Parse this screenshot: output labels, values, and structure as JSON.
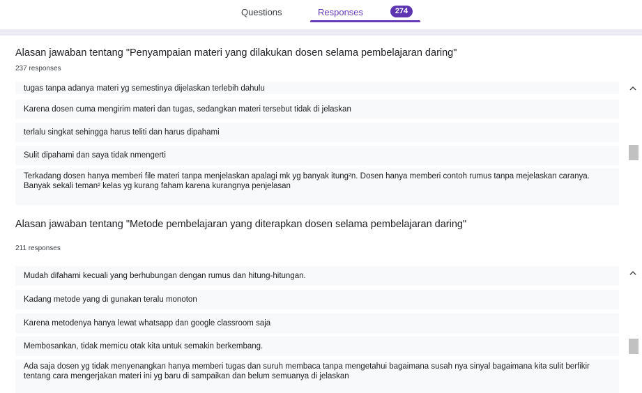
{
  "tabs": {
    "questions_label": "Questions",
    "responses_label": "Responses",
    "responses_count": "274"
  },
  "questions": [
    {
      "title": "Alasan jawaban tentang \"Penyampaian materi yang dilakukan dosen selama pembelajaran daring\"",
      "response_count": "237 responses",
      "responses": [
        "tugas tanpa adanya materi yg semestinya dijelaskan terlebih dahulu",
        "Karena dosen cuma mengirim materi dan tugas, sedangkan materi tersebut tidak di jelaskan",
        "terlalu singkat sehingga harus teliti dan harus dipahami",
        "Sulit dipahami dan saya tidak nmengerti",
        "Terkadang dosen hanya memberi file materi tanpa menjelaskan apalagi mk yg banyak itung²n. Dosen hanya memberi contoh rumus tanpa mejelaskan caranya. Banyak sekali teman² kelas yg kurang faham karena kurangnya penjelasan"
      ]
    },
    {
      "title": "Alasan jawaban tentang \"Metode pembelajaran yang diterapkan dosen selama pembelajaran daring\"",
      "response_count": "211 responses",
      "responses": [
        "Mudah difahami kecuali yang berhubungan dengan rumus dan hitung-hitungan.",
        "Kadang metode yang di gunakan teralu monoton",
        "Karena metodenya hanya lewat whatsapp dan google classroom saja",
        "Membosankan, tidak memicu otak kita untuk semakin berkembang.",
        "Ada saja dosen yg tidak menyenangkan hanya memberi tugas dan suruh membaca tanpa mengetahui bagaimana susah nya sinyal bagaimana kita sulit berfikir tentang cara mengerjakan materi ini yg baru di sampaikan dan belum semuanya di jelaskan"
      ]
    }
  ],
  "icons": {
    "scroll_up": "chevron-up-icon"
  },
  "colors": {
    "accent": "#673ab7",
    "badge": "#5e35b1",
    "response_bg": "#f8f9fa",
    "strip": "#ecebf4"
  }
}
